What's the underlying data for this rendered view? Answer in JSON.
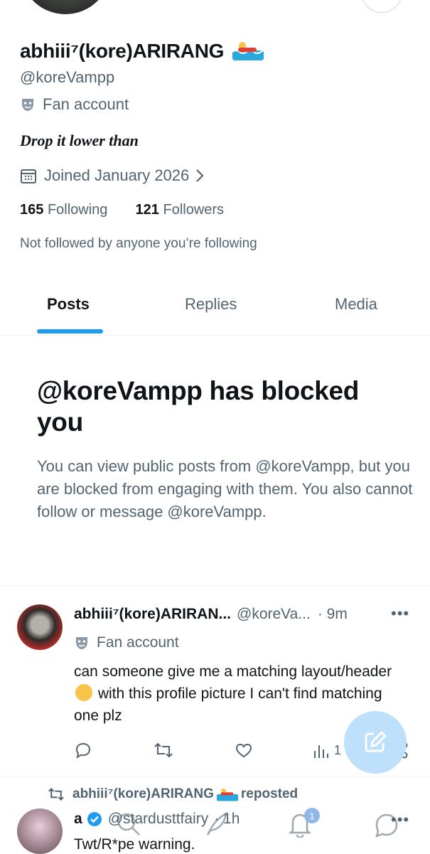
{
  "profile": {
    "display_name": "abhiii⁷(kore)ARIRANG",
    "handle": "@koreVampp",
    "category_label": "Fan account",
    "bio": "Drop it lower than",
    "joined": "Joined January 2026",
    "following_count": "165",
    "following_label": "Following",
    "followers_count": "121",
    "followers_label": "Followers",
    "followed_by": "Not followed by anyone you’re following"
  },
  "tabs": [
    {
      "label": "Posts",
      "active": true
    },
    {
      "label": "Replies",
      "active": false
    },
    {
      "label": "Media",
      "active": false
    }
  ],
  "blocked": {
    "title": "@koreVampp has blocked you",
    "body": "You can view public posts from @koreVampp, but you are blocked from engaging with them. You also cannot follow or message @koreVampp."
  },
  "post": {
    "name": "abhiii⁷(kore)ARIRAN...",
    "handle": "@koreVa...",
    "time": "· 9m",
    "more": "•••",
    "category_label": "Fan account",
    "text_before": "can someone give me a matching layout/header",
    "text_after": "with this profile picture I can't find matching one plz",
    "views": "1"
  },
  "repost": {
    "label_name": "abhiii⁷(kore)ARIRANG",
    "label_suffix": "reposted",
    "name": "a",
    "handle": "@stardusttfairy",
    "time": "· 1h",
    "more": "•••",
    "text": "Twt/R*pe warning."
  },
  "nav": {
    "notifications_badge": "1"
  },
  "colors": {
    "accent": "#1d9bf0",
    "secondary_text": "#536471",
    "primary_text": "#0f1419",
    "verified": "#1d9bf0",
    "fab": "#bfe0fb"
  }
}
